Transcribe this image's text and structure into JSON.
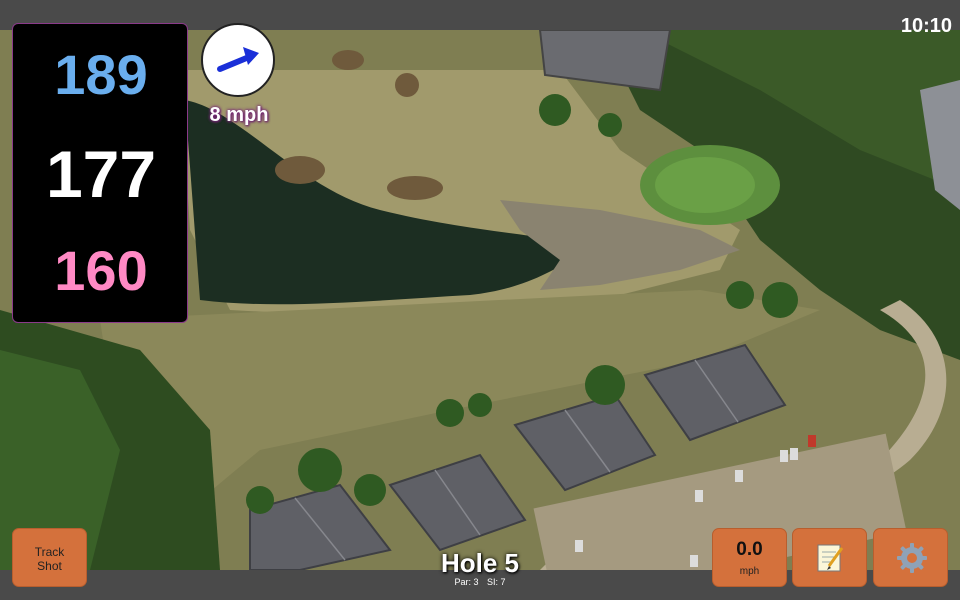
{
  "status": {
    "time": "10:10"
  },
  "distances": {
    "back": "189",
    "middle": "177",
    "front": "160"
  },
  "wind": {
    "speed": "8 mph",
    "direction_icon": "arrow-icon",
    "arrow_color": "#1a2fd8"
  },
  "buttons": {
    "track_shot": [
      "Track",
      "Shot"
    ],
    "speed": {
      "value": "0.0",
      "unit": "mph"
    },
    "notes_icon": "notepad-icon",
    "settings_icon": "gear-icon"
  },
  "hole": {
    "title": "Hole 5",
    "par": "Par: 3",
    "si": "SI: 7"
  },
  "colors": {
    "accent": "#d4713c",
    "back": "#6aaeee",
    "middle": "#ffffff",
    "front": "#ff89c4",
    "panel": "#000000"
  }
}
